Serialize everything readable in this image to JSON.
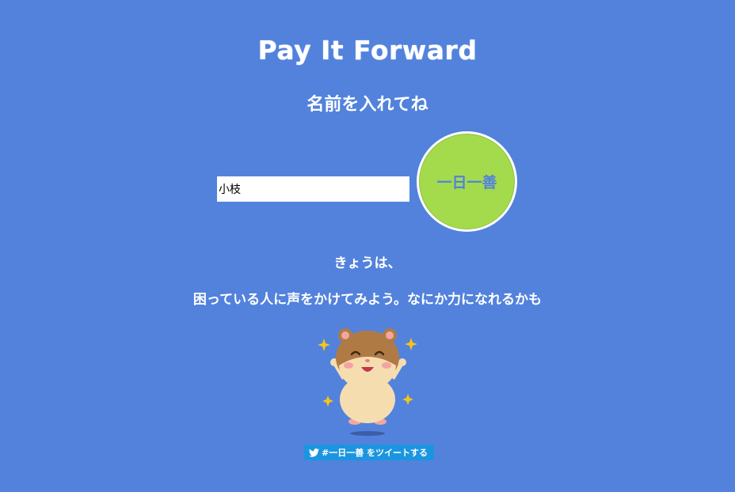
{
  "header": {
    "title": "Pay It Forward",
    "prompt": "名前を入れてね"
  },
  "form": {
    "name_value": "小枝",
    "submit_label": "一日一善"
  },
  "message": {
    "line1": "きょうは、",
    "line2": "困っている人に声をかけてみよう。なにか力になれるかも"
  },
  "illustration": {
    "icon": "hamster-illustration"
  },
  "tweet": {
    "label": "#一日一善 をツイートする",
    "icon": "twitter-bird-icon",
    "color": "#1B95E0"
  },
  "colors": {
    "background": "#5282DC",
    "button": "#A4DB4C"
  }
}
